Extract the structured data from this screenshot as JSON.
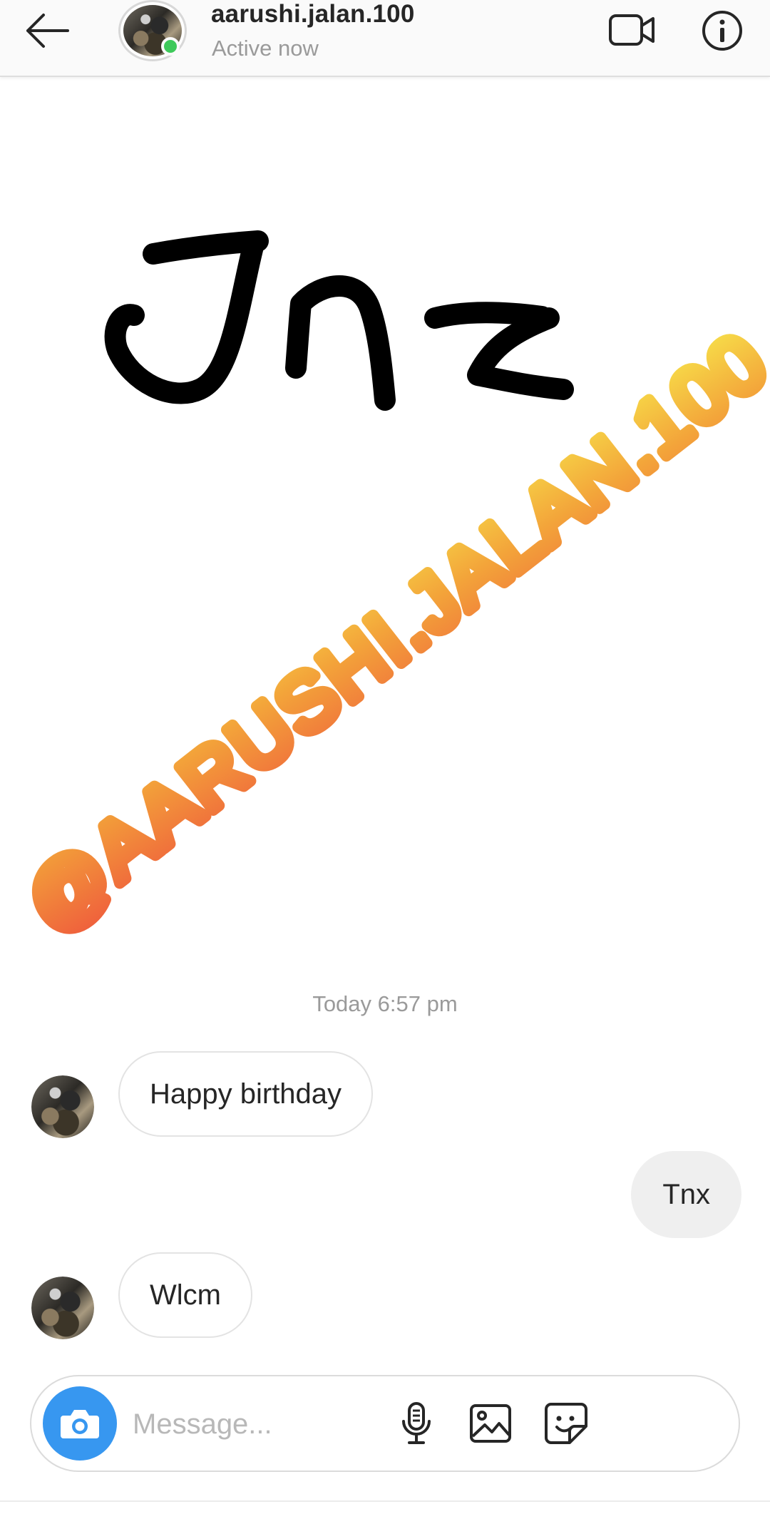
{
  "header": {
    "username": "aarushi.jalan.100",
    "status": "Active now",
    "icons": {
      "back": "arrow-left-icon",
      "video": "video-camera-icon",
      "info": "info-icon"
    },
    "online_color": "#3ec95a"
  },
  "drawing": {
    "handwritten_text": "Tnx",
    "watermark_text": "@AARUSHI.JALAN.100",
    "watermark_colors": [
      "#ef5f3c",
      "#f7e24a"
    ]
  },
  "conversation": {
    "timestamp": "Today 6:57 pm",
    "messages": [
      {
        "direction": "incoming",
        "text": "Happy birthday"
      },
      {
        "direction": "outgoing",
        "text": "Tnx"
      },
      {
        "direction": "incoming",
        "text": "Wlcm"
      }
    ]
  },
  "composer": {
    "placeholder": "Message...",
    "icons": {
      "camera": "camera-icon",
      "mic": "microphone-icon",
      "gallery": "image-icon",
      "sticker": "sticker-icon"
    },
    "accent": "#3797f0"
  }
}
